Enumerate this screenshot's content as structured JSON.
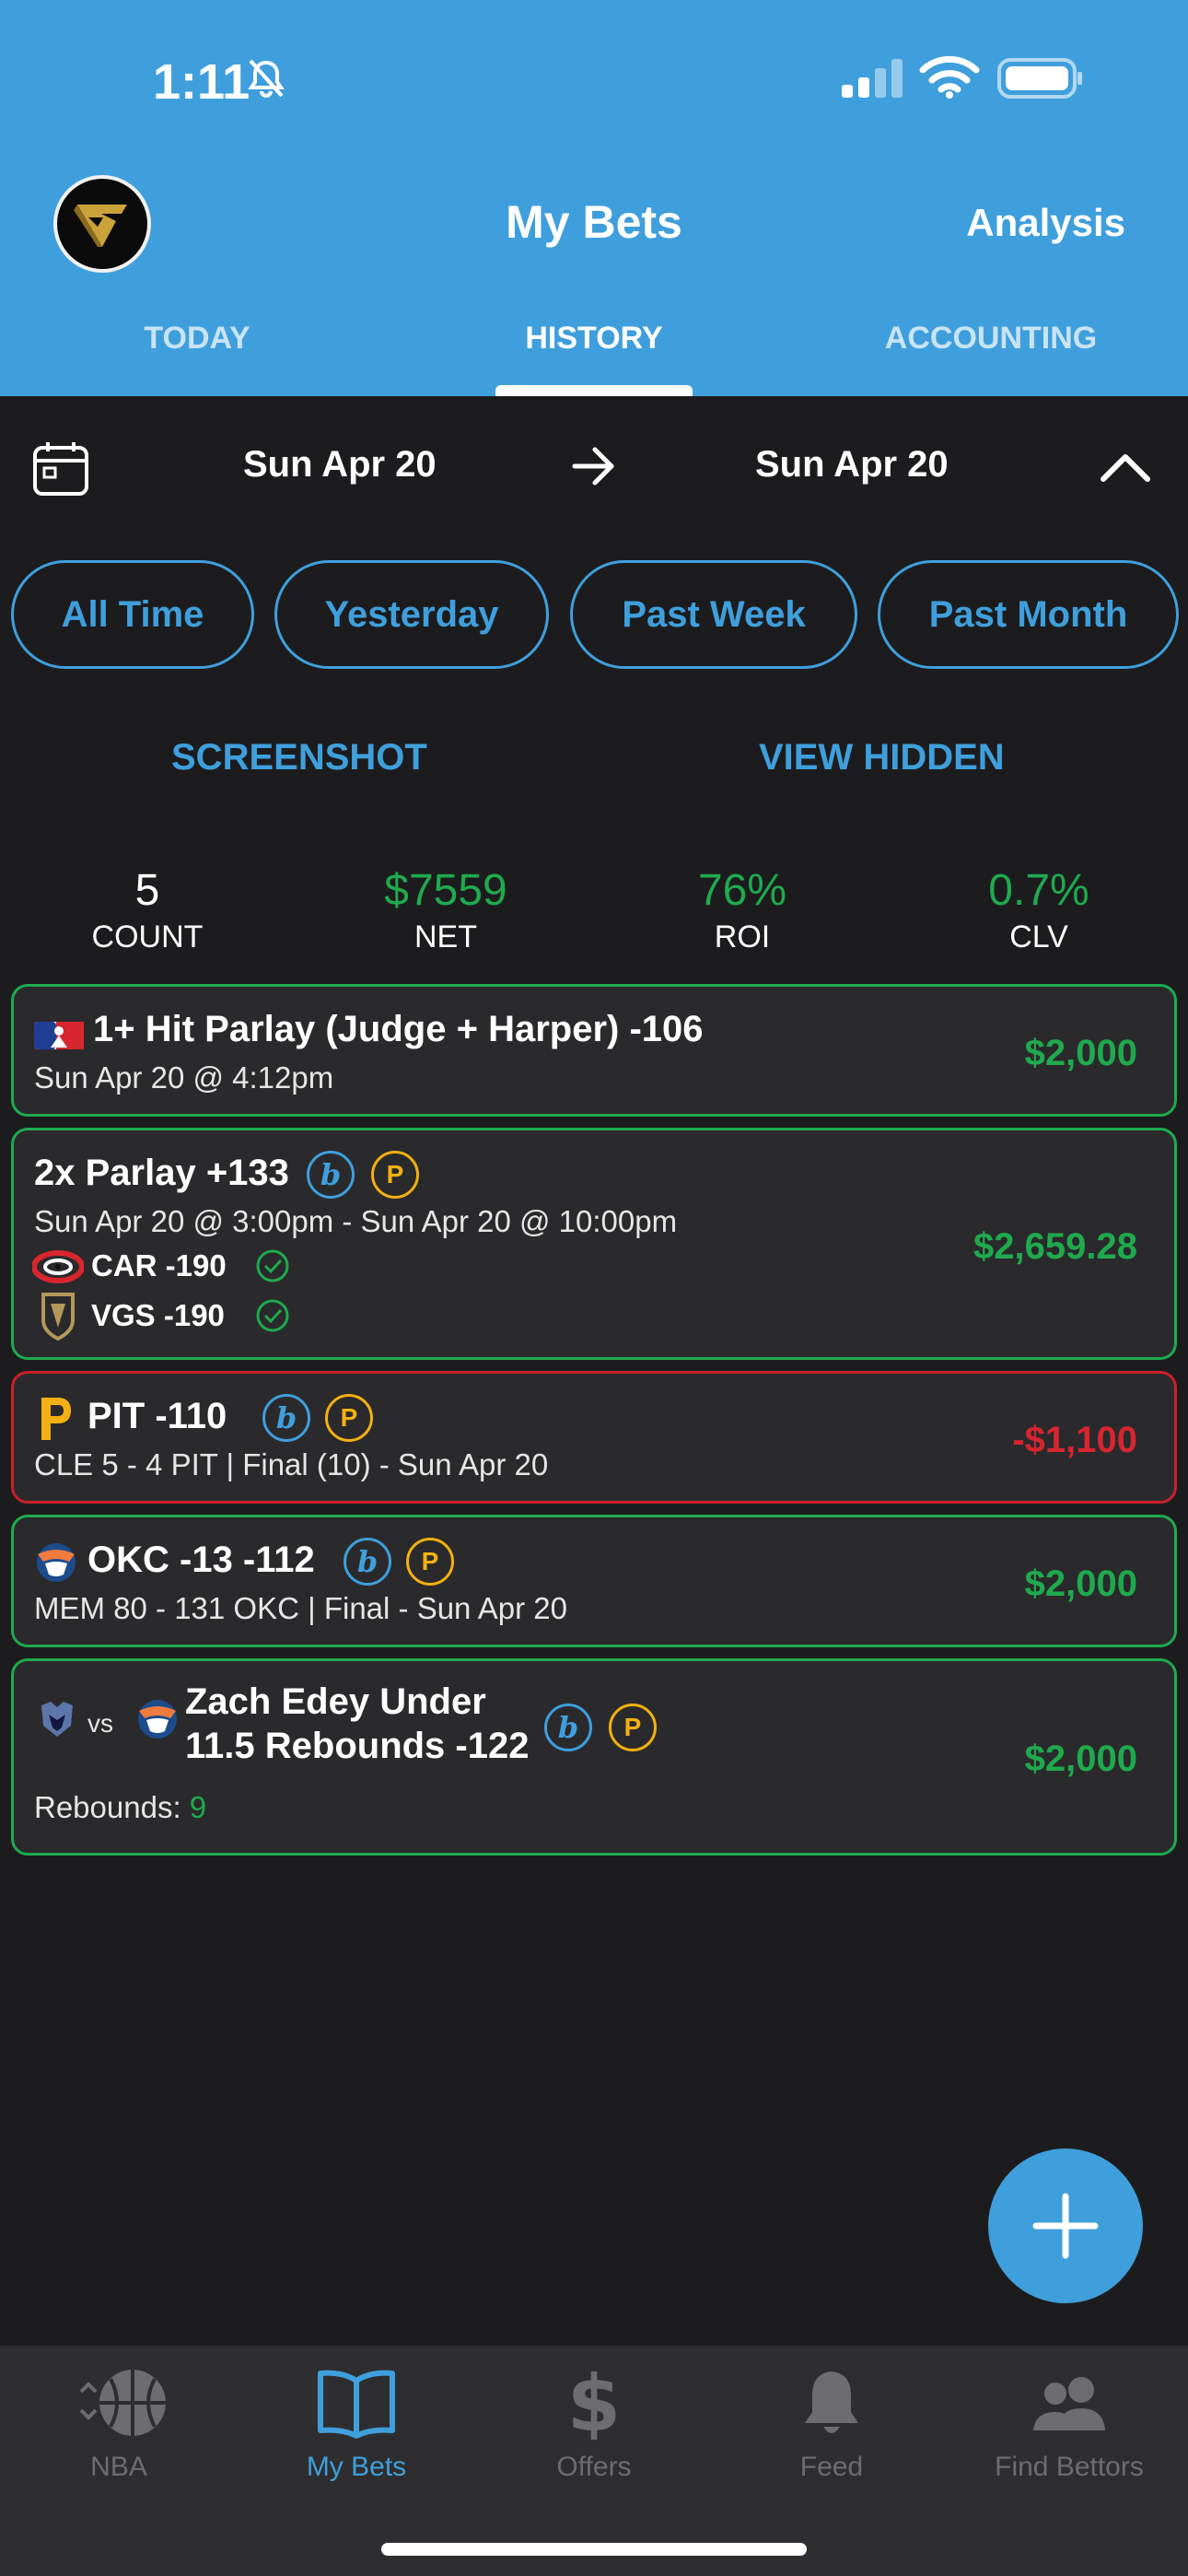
{
  "status_bar": {
    "time": "1:11"
  },
  "header": {
    "title": "My Bets",
    "analysis": "Analysis",
    "tabs": [
      {
        "label": "TODAY"
      },
      {
        "label": "HISTORY"
      },
      {
        "label": "ACCOUNTING"
      }
    ],
    "active_tab": "HISTORY"
  },
  "date_range": {
    "start": "Sun Apr 20",
    "end": "Sun Apr 20"
  },
  "filters": [
    "All Time",
    "Yesterday",
    "Past Week",
    "Past Month"
  ],
  "actions": {
    "screenshot": "SCREENSHOT",
    "view_hidden": "VIEW HIDDEN"
  },
  "stats": [
    {
      "value": "5",
      "label": "COUNT",
      "color": "#ffffff"
    },
    {
      "value": "$7559",
      "label": "NET",
      "color": "#1faa4e"
    },
    {
      "value": "76%",
      "label": "ROI",
      "color": "#1faa4e"
    },
    {
      "value": "0.7%",
      "label": "CLV",
      "color": "#1faa4e"
    }
  ],
  "bets": [
    {
      "title": "1+ Hit Parlay (Judge + Harper) -106",
      "subtitle": "Sun Apr 20 @ 4:12pm",
      "amount": "$2,000",
      "result": "win",
      "icon": "mlb-logo-icon"
    },
    {
      "title": "2x Parlay +133",
      "subtitle": "Sun Apr 20 @ 3:00pm - Sun Apr 20 @ 10:00pm",
      "legs": [
        {
          "team": "CAR -190",
          "icon": "hurricanes-logo-icon"
        },
        {
          "team": "VGS -190",
          "icon": "golden-knights-logo-icon"
        }
      ],
      "amount": "$2,659.28",
      "result": "win",
      "badges": [
        "b",
        "P"
      ]
    },
    {
      "title": "PIT -110",
      "subtitle": "CLE 5 - 4 PIT | Final (10) - Sun Apr 20",
      "amount": "-$1,100",
      "result": "loss",
      "badges": [
        "b",
        "P"
      ],
      "icon": "pirates-logo-icon"
    },
    {
      "title": "OKC -13 -112",
      "subtitle": "MEM 80 - 131 OKC | Final  - Sun Apr 20",
      "amount": "$2,000",
      "result": "win",
      "badges": [
        "b",
        "P"
      ],
      "icon": "thunder-logo-icon"
    },
    {
      "title_line1": "Zach Edey Under",
      "title_line2": "11.5 Rebounds -122",
      "vs": "vs",
      "stat_label": "Rebounds:",
      "stat_value": "9",
      "amount": "$2,000",
      "result": "win",
      "badges": [
        "b",
        "P"
      ]
    }
  ],
  "bottom_nav": [
    {
      "label": "NBA",
      "icon": "basketball-icon"
    },
    {
      "label": "My Bets",
      "icon": "book-icon"
    },
    {
      "label": "Offers",
      "icon": "dollar-icon"
    },
    {
      "label": "Feed",
      "icon": "bell-icon"
    },
    {
      "label": "Find Bettors",
      "icon": "people-icon"
    }
  ],
  "colors": {
    "accent": "#3f9fdc",
    "win": "#1faa4e",
    "loss": "#d72630",
    "pending_badge": "#f3b012"
  }
}
